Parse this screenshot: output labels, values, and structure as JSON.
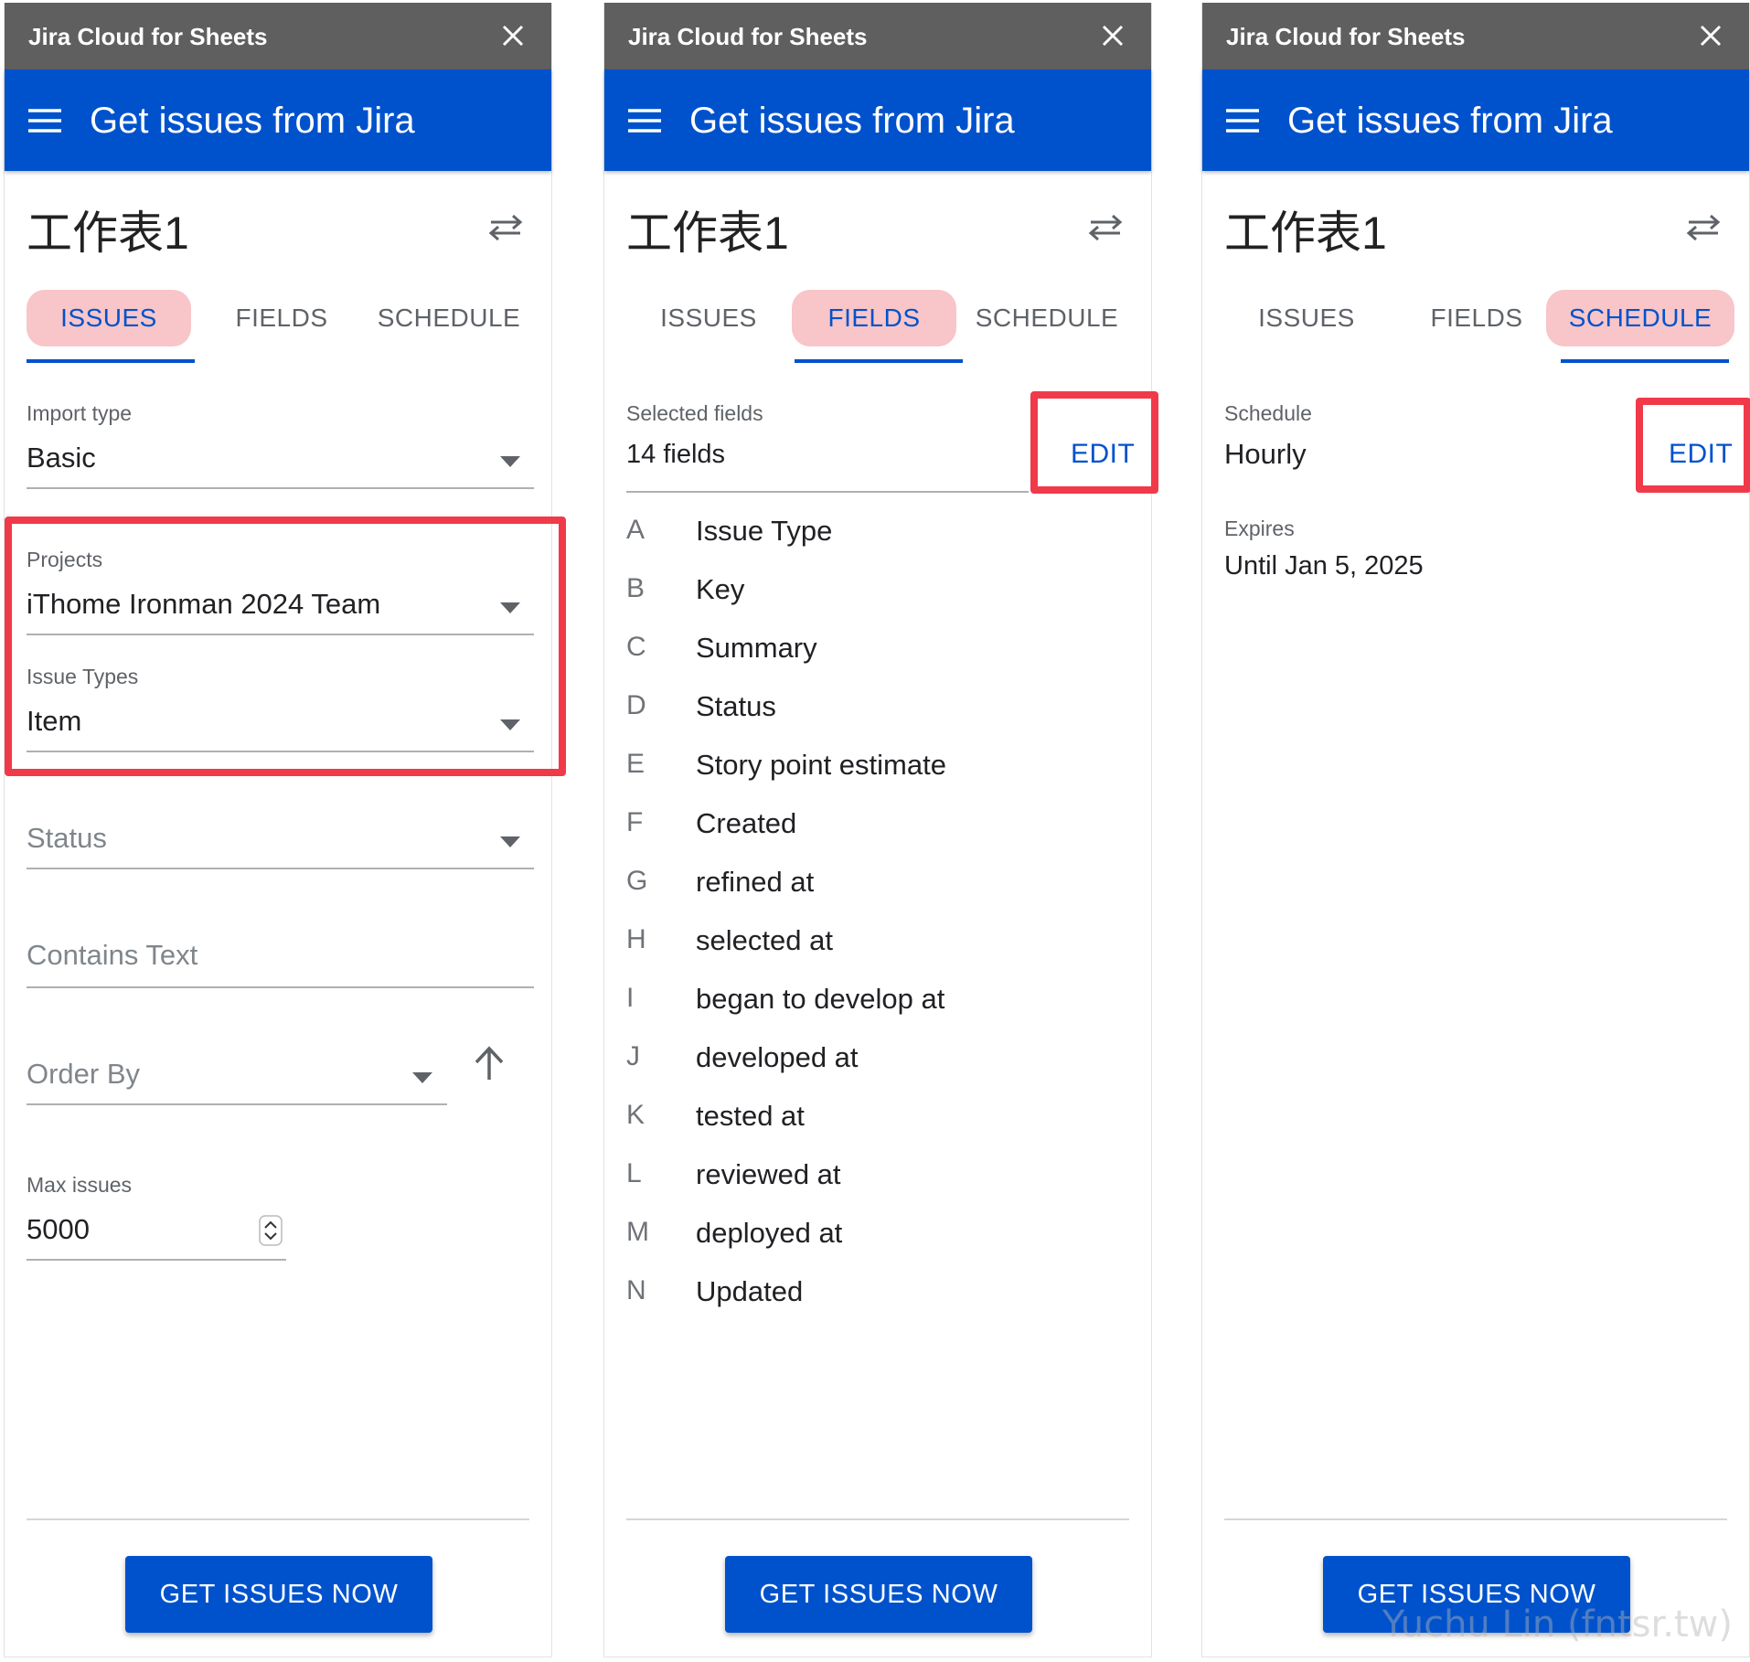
{
  "app_name": "Jira Cloud for Sheets",
  "page_title": "Get issues from Jira",
  "sheet_name": "工作表1",
  "tabs": [
    "ISSUES",
    "FIELDS",
    "SCHEDULE"
  ],
  "get_issues_button": "GET ISSUES NOW",
  "highlight_color": "#f03a4a",
  "accent_color": "#0052cc",
  "issues_panel": {
    "import_type": {
      "label": "Import type",
      "value": "Basic"
    },
    "projects": {
      "label": "Projects",
      "value": "iThome Ironman 2024 Team"
    },
    "issue_types": {
      "label": "Issue Types",
      "value": "Item"
    },
    "status": {
      "placeholder": "Status"
    },
    "contains_text": {
      "placeholder": "Contains Text"
    },
    "order_by": {
      "placeholder": "Order By"
    },
    "max_issues": {
      "label": "Max issues",
      "value": "5000"
    }
  },
  "fields_panel": {
    "label": "Selected fields",
    "count": "14 fields",
    "edit": "EDIT",
    "fields": [
      {
        "letter": "A",
        "name": "Issue Type"
      },
      {
        "letter": "B",
        "name": "Key"
      },
      {
        "letter": "C",
        "name": "Summary"
      },
      {
        "letter": "D",
        "name": "Status"
      },
      {
        "letter": "E",
        "name": "Story point estimate"
      },
      {
        "letter": "F",
        "name": "Created"
      },
      {
        "letter": "G",
        "name": "refined at"
      },
      {
        "letter": "H",
        "name": "selected at"
      },
      {
        "letter": "I",
        "name": "began to develop at"
      },
      {
        "letter": "J",
        "name": "developed at"
      },
      {
        "letter": "K",
        "name": "tested at"
      },
      {
        "letter": "L",
        "name": "reviewed at"
      },
      {
        "letter": "M",
        "name": "deployed at"
      },
      {
        "letter": "N",
        "name": "Updated"
      }
    ]
  },
  "schedule_panel": {
    "schedule": {
      "label": "Schedule",
      "value": "Hourly"
    },
    "edit": "EDIT",
    "expires": {
      "label": "Expires",
      "value": "Until Jan 5, 2025"
    }
  },
  "watermark": "Yuchu Lin (fntsr.tw)"
}
